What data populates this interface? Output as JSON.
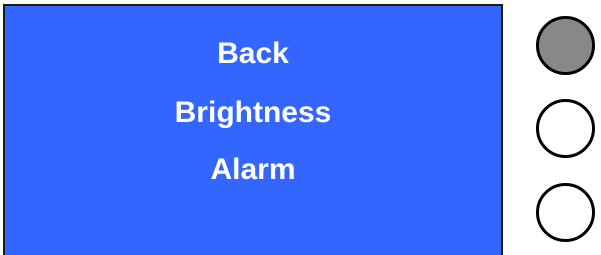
{
  "display": {
    "background_color": "#3366ff",
    "menu_items": [
      {
        "label": "Back"
      },
      {
        "label": "Brightness"
      },
      {
        "label": "Alarm"
      }
    ]
  },
  "side_buttons": [
    {
      "state": "pressed",
      "color": "#888888"
    },
    {
      "state": "released",
      "color": "#ffffff"
    },
    {
      "state": "released",
      "color": "#ffffff"
    }
  ]
}
